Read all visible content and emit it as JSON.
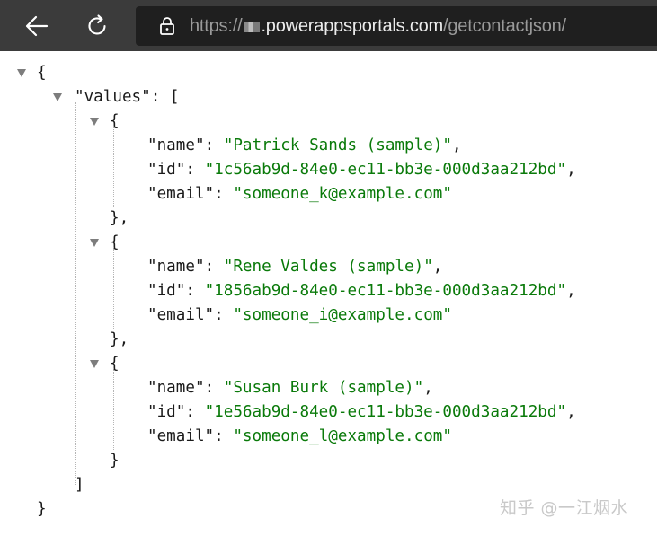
{
  "browser": {
    "back_icon": "arrow-left-icon",
    "refresh_icon": "refresh-icon",
    "lock_icon": "lock-icon",
    "url_scheme": "https://",
    "url_host": ".powerappsportals.com",
    "url_path": "/getcontactjson/"
  },
  "json_view": {
    "open_brace": "{",
    "values_key": "\"values\"",
    "values_sep": ": [",
    "records": [
      {
        "open": "{",
        "name_key": "\"name\"",
        "name_value": "\"Patrick Sands (sample)\"",
        "id_key": "\"id\"",
        "id_value": "\"1c56ab9d-84e0-ec11-bb3e-000d3aa212bd\"",
        "email_key": "\"email\"",
        "email_value": "\"someone_k@example.com\"",
        "close": "},"
      },
      {
        "open": "{",
        "name_key": "\"name\"",
        "name_value": "\"Rene Valdes (sample)\"",
        "id_key": "\"id\"",
        "id_value": "\"1856ab9d-84e0-ec11-bb3e-000d3aa212bd\"",
        "email_key": "\"email\"",
        "email_value": "\"someone_i@example.com\"",
        "close": "},"
      },
      {
        "open": "{",
        "name_key": "\"name\"",
        "name_value": "\"Susan Burk (sample)\"",
        "id_key": "\"id\"",
        "id_value": "\"1e56ab9d-84e0-ec11-bb3e-000d3aa212bd\"",
        "email_key": "\"email\"",
        "email_value": "\"someone_l@example.com\"",
        "close": "}"
      }
    ],
    "close_bracket": "]",
    "close_brace": "}",
    "colon": ": ",
    "comma": ","
  },
  "watermark": "知乎 @一江烟水",
  "colors": {
    "string": "#0a7a0a",
    "toolbar": "#3b3b3b",
    "address_bar": "#1f1f1f"
  }
}
